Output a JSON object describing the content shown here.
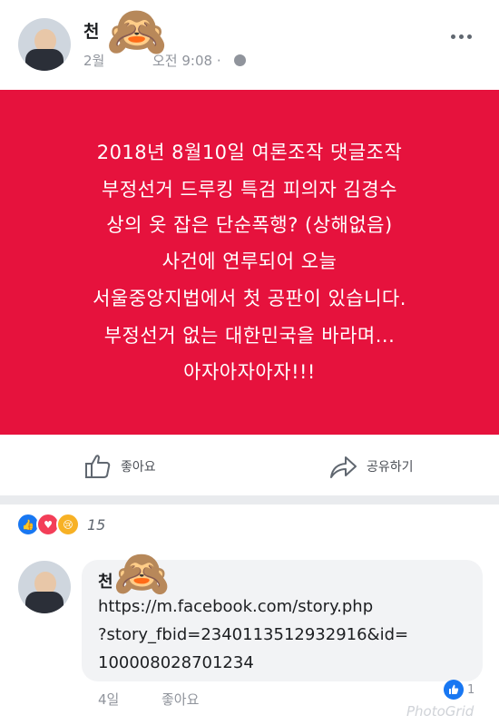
{
  "post": {
    "author_partial": "천",
    "timestamp_partial_left": "2월",
    "timestamp_partial_right": "오전 9:08 ·",
    "privacy_icon": "globe-icon",
    "more_icon": "more-dots-icon",
    "privacy_mask_icon": "monkey-see-no-evil-icon",
    "banner_color": "#e6123d",
    "banner_lines": [
      "2018년 8월10일 여론조작 댓글조작",
      "부정선거 드루킹 특검 피의자 김경수",
      "상의 옷 잡은 단순폭행? (상해없음)",
      "사건에 연루되어 오늘",
      "서울중앙지법에서 첫 공판이 있습니다.",
      "부정선거 없는 대한민국을 바라며...",
      "아자아자아자!!!"
    ]
  },
  "actions": {
    "like_label": "좋아요",
    "share_label": "공유하기"
  },
  "reactions": {
    "count": "15",
    "types": [
      "like",
      "love",
      "sad"
    ]
  },
  "comment": {
    "author_partial": "천",
    "text_lines": [
      "https://m.facebook.com/story.php",
      "?story_fbid=2340113512932916&id=",
      "100008028701234"
    ],
    "time": "4일",
    "like_label": "좋아요",
    "like_count": "1"
  },
  "watermark": "PhotoGrid"
}
